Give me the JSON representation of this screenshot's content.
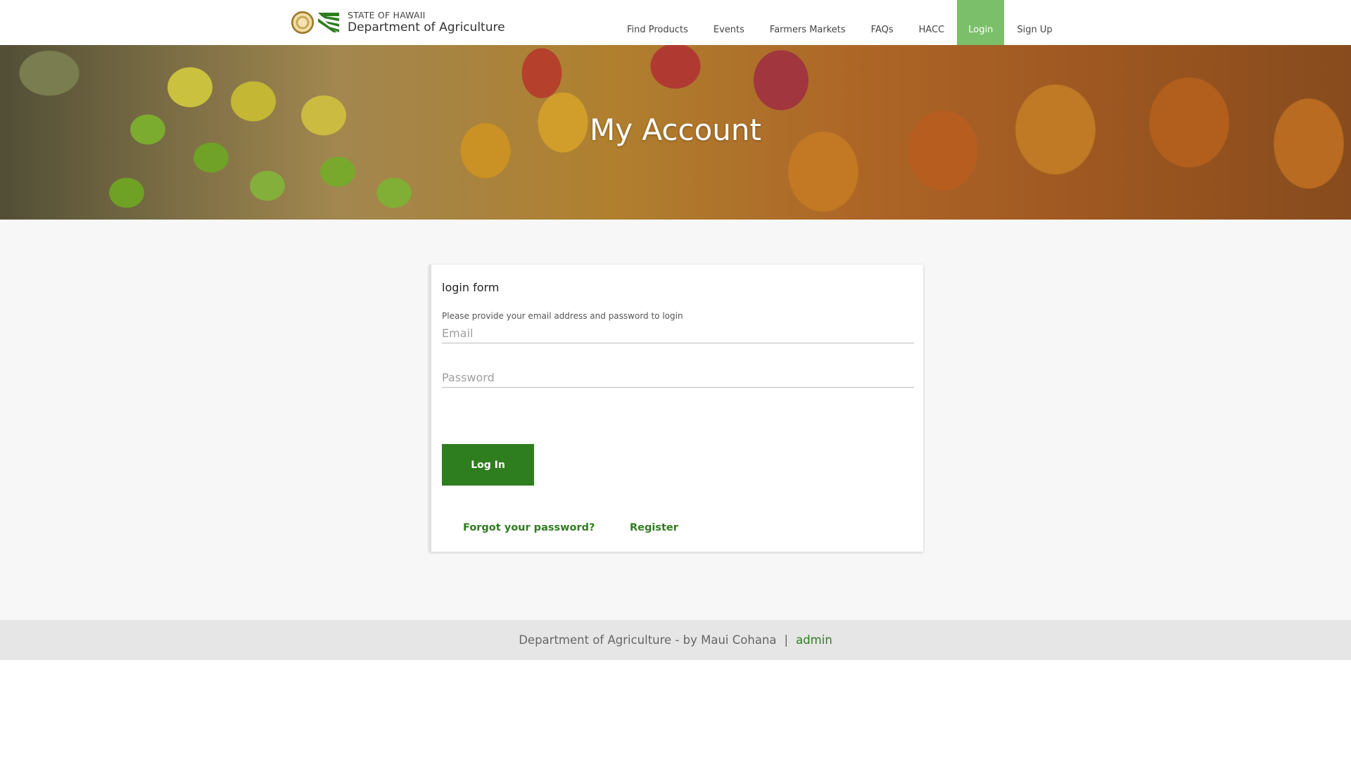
{
  "brand": {
    "state": "STATE OF HAWAII",
    "department": "Department of Agriculture",
    "seal_icon": "state-seal",
    "logo_icon": "agriculture-logo"
  },
  "nav": {
    "items": [
      {
        "label": "Find Products",
        "active": false
      },
      {
        "label": "Events",
        "active": false
      },
      {
        "label": "Farmers Markets",
        "active": false
      },
      {
        "label": "FAQs",
        "active": false
      },
      {
        "label": "HACC",
        "active": false
      },
      {
        "label": "Login",
        "active": true
      },
      {
        "label": "Sign Up",
        "active": false
      }
    ],
    "active_color": "#7bbf6a"
  },
  "hero": {
    "title": "My Account"
  },
  "login_form": {
    "title": "login form",
    "subtitle": "Please provide your email address and password to login",
    "email": {
      "placeholder": "Email",
      "value": ""
    },
    "password": {
      "placeholder": "Password",
      "value": ""
    },
    "submit_label": "Log In",
    "forgot_label": "Forgot your password?",
    "register_label": "Register"
  },
  "footer": {
    "text": "Department of Agriculture - by Maui Cohana",
    "separator": "|",
    "admin_label": "admin"
  },
  "colors": {
    "accent_green": "#2e7d1f",
    "nav_active": "#7bbf6a",
    "footer_bg": "#e6e6e6",
    "page_bg": "#f7f7f7"
  }
}
